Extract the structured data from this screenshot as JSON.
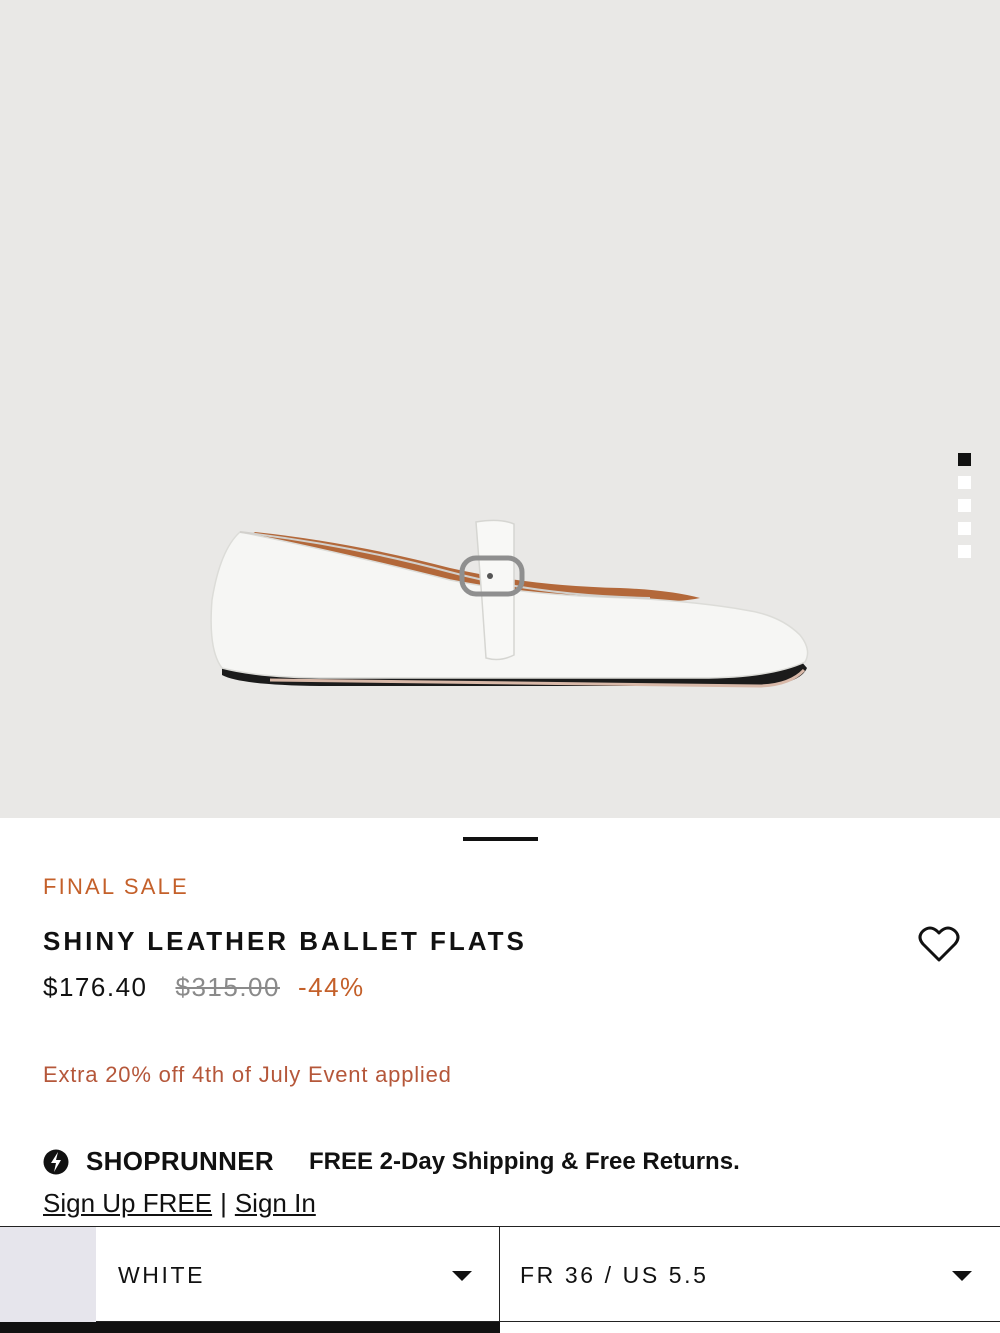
{
  "gallery": {
    "image_count": 5,
    "active_index": 0,
    "product_color": "#ffffff",
    "background_color": "#e9e8e6"
  },
  "product": {
    "badge": "FINAL SALE",
    "title": "SHINY LEATHER BALLET FLATS",
    "price": "$176.40",
    "original_price": "$315.00",
    "discount": "-44%",
    "promo": "Extra 20% off 4th of July Event applied",
    "wishlist_icon": "heart-outline-icon"
  },
  "shoprunner": {
    "brand": "SHOPRUNNER",
    "message": "FREE 2-Day Shipping & Free Returns.",
    "signup_label": "Sign Up FREE",
    "separator": "|",
    "signin_label": "Sign In"
  },
  "selectors": {
    "color": {
      "value": "WHITE",
      "swatch": "#e6e5ec"
    },
    "size": {
      "value": "FR 36 / US 5.5"
    }
  },
  "colors": {
    "accent": "#c4602a",
    "promo": "#b5573a",
    "text": "#111111"
  }
}
